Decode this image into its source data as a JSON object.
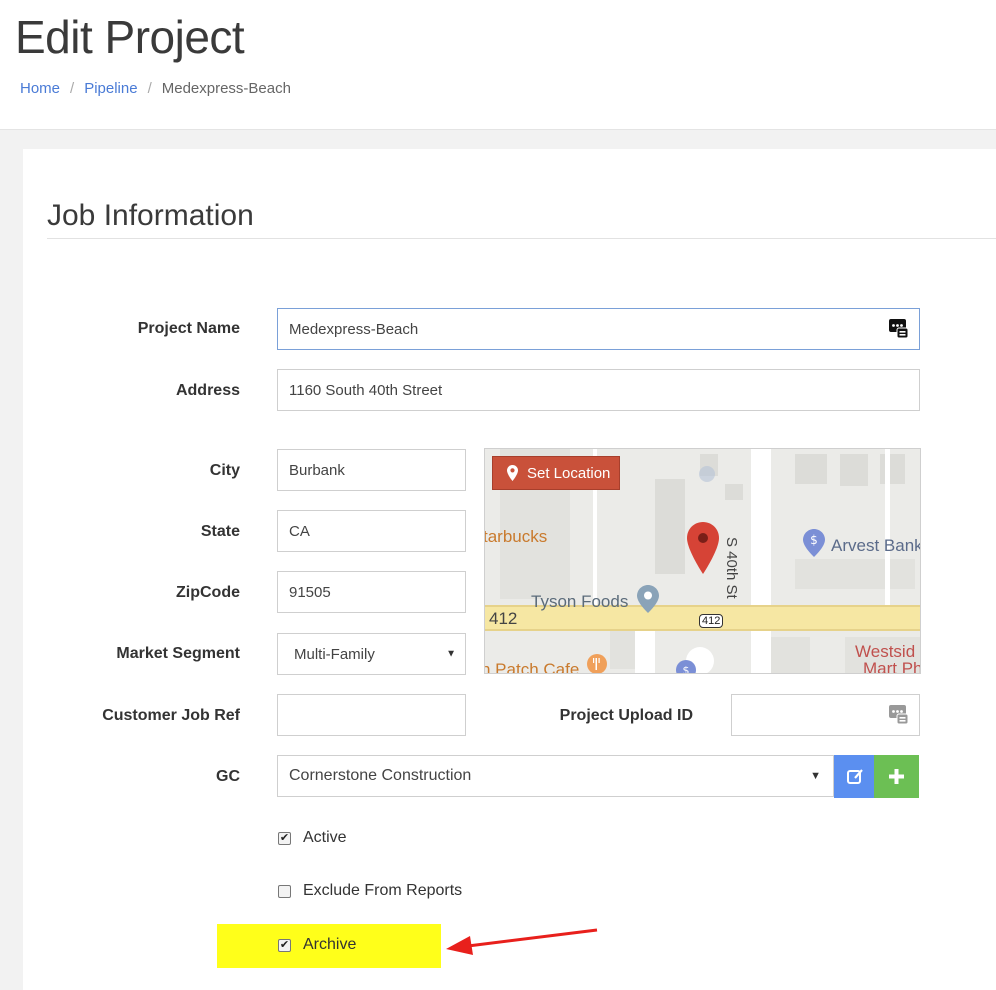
{
  "page": {
    "title": "Edit Project",
    "breadcrumb": [
      {
        "label": "Home"
      },
      {
        "label": "Pipeline"
      },
      {
        "label": "Medexpress-Beach"
      }
    ]
  },
  "section": {
    "title": "Job Information"
  },
  "form": {
    "project_name": {
      "label": "Project Name",
      "value": "Medexpress-Beach"
    },
    "address": {
      "label": "Address",
      "value": "1160 South 40th Street"
    },
    "city": {
      "label": "City",
      "value": "Burbank"
    },
    "state": {
      "label": "State",
      "value": "CA"
    },
    "zipcode": {
      "label": "ZipCode",
      "value": "91505"
    },
    "market_segment": {
      "label": "Market Segment",
      "value": "Multi-Family"
    },
    "customer_job_ref": {
      "label": "Customer Job Ref",
      "value": ""
    },
    "project_upload_id": {
      "label": "Project Upload ID",
      "value": ""
    },
    "gc": {
      "label": "GC",
      "value": "Cornerstone Construction"
    },
    "checkboxes": [
      {
        "label": "Active",
        "checked": true
      },
      {
        "label": "Exclude From Reports",
        "checked": false
      },
      {
        "label": "Archive",
        "checked": true
      }
    ]
  },
  "map": {
    "button_label": "Set Location",
    "labels": {
      "starbucks": "tarbucks",
      "tyson": "Tyson Foods",
      "arvest": "Arvest Bank",
      "street": "S 40th St",
      "hwy": "412",
      "hwy_shield": "412",
      "patch": "n Patch Cafe",
      "westside1": "Westsid",
      "westside2": "Mart Ph"
    }
  },
  "colors": {
    "link": "#4a7bd6",
    "set_location": "#c9513a",
    "edit_btn": "#5b8ff0",
    "add_btn": "#6cbf54",
    "highlight": "#ffff1a",
    "arrow": "#e8201c"
  }
}
